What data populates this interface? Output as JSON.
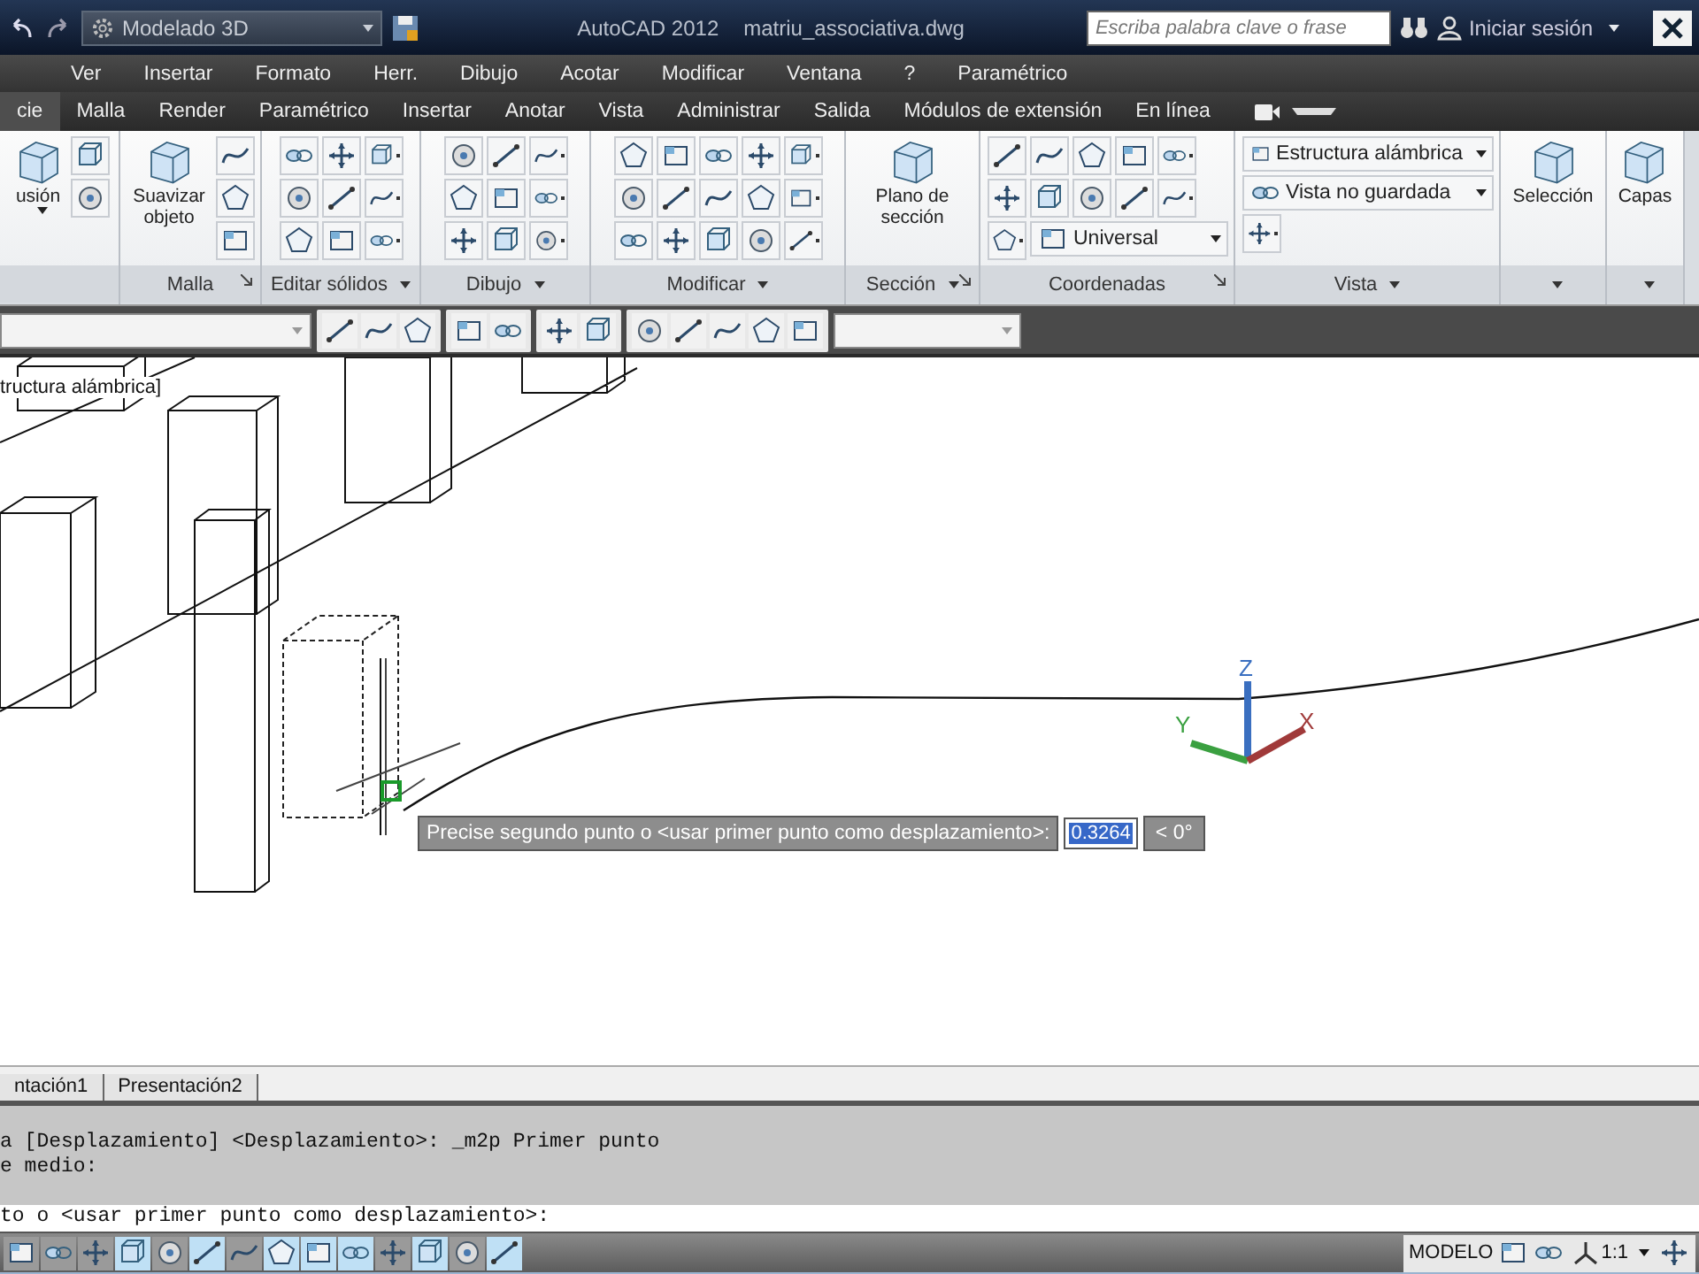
{
  "title_bar": {
    "workspace": "Modelado 3D",
    "app": "AutoCAD 2012",
    "file": "matriu_associativa.dwg",
    "search": {
      "placeholder": "Escriba palabra clave o frase"
    },
    "sign_in": "Iniciar sesión"
  },
  "menu_bar": [
    "Ver",
    "Insertar",
    "Formato",
    "Herr.",
    "Dibujo",
    "Acotar",
    "Modificar",
    "Ventana",
    "?",
    "Paramétrico"
  ],
  "ribbon_tabs": [
    {
      "label": "cie",
      "selected": true
    },
    {
      "label": "Malla",
      "selected": false
    },
    {
      "label": "Render",
      "selected": false
    },
    {
      "label": "Paramétrico",
      "selected": false
    },
    {
      "label": "Insertar",
      "selected": false
    },
    {
      "label": "Anotar",
      "selected": false
    },
    {
      "label": "Vista",
      "selected": false
    },
    {
      "label": "Administrar",
      "selected": false
    },
    {
      "label": "Salida",
      "selected": false
    },
    {
      "label": "Módulos de extensión",
      "selected": false
    },
    {
      "label": "En línea",
      "selected": false
    }
  ],
  "ribbon_panels": [
    {
      "menu": false,
      "launcher": false,
      "items": [
        {
          "kind": "large",
          "label": "usión",
          "caret": true
        }
      ]
    },
    {
      "title": "Malla",
      "menu": false,
      "launcher": true,
      "items": [
        {
          "kind": "large",
          "label": "Suavizar objeto",
          "caret": false
        }
      ]
    },
    {
      "title": "Editar sólidos",
      "menu": true,
      "launcher": false
    },
    {
      "title": "Dibujo",
      "menu": true,
      "launcher": false
    },
    {
      "title": "Modificar",
      "menu": true,
      "launcher": false
    },
    {
      "title": "Sección",
      "menu": true,
      "launcher": true,
      "items": [
        {
          "kind": "large",
          "label": "Plano de sección",
          "caret": false
        }
      ]
    },
    {
      "title": "Coordenadas",
      "menu": false,
      "launcher": true,
      "items": [
        {
          "kind": "combo",
          "label": "Universal"
        }
      ]
    },
    {
      "title": "Vista",
      "menu": true,
      "launcher": false,
      "items": [
        {
          "kind": "combo",
          "label": "Estructura alámbrica"
        },
        {
          "kind": "combo",
          "label": "Vista no guardada"
        }
      ]
    },
    {
      "menu": true,
      "launcher": false,
      "items": [
        {
          "kind": "large",
          "label": "Selección",
          "caret": false
        }
      ]
    },
    {
      "menu": true,
      "launcher": false,
      "items": [
        {
          "kind": "large",
          "label": "Capas",
          "caret": false
        }
      ]
    }
  ],
  "viewport": {
    "label": "tructura alámbrica]",
    "axes": [
      "X",
      "Y",
      "Z"
    ],
    "prompt": {
      "text": "Precise segundo punto o <usar primer punto como desplazamiento>:",
      "value": "0.3264",
      "angle": "< 0°"
    }
  },
  "layout_tabs": [
    {
      "label": "ntación1",
      "selected": false
    },
    {
      "label": "Presentación2",
      "selected": false
    }
  ],
  "command": {
    "history": [
      "a [Desplazamiento] <Desplazamiento>: _m2p Primer punto",
      "e medio:"
    ],
    "input": "to o <usar primer punto como desplazamiento>:"
  },
  "status_bar": {
    "toggles": [
      {
        "on": false
      },
      {
        "on": false
      },
      {
        "on": false
      },
      {
        "on": true
      },
      {
        "on": false
      },
      {
        "on": true
      },
      {
        "on": false
      },
      {
        "on": true
      },
      {
        "on": true
      },
      {
        "on": true
      },
      {
        "on": false
      },
      {
        "on": true
      },
      {
        "on": false
      },
      {
        "on": true
      }
    ],
    "space": "MODELO",
    "scale": "1:1"
  }
}
